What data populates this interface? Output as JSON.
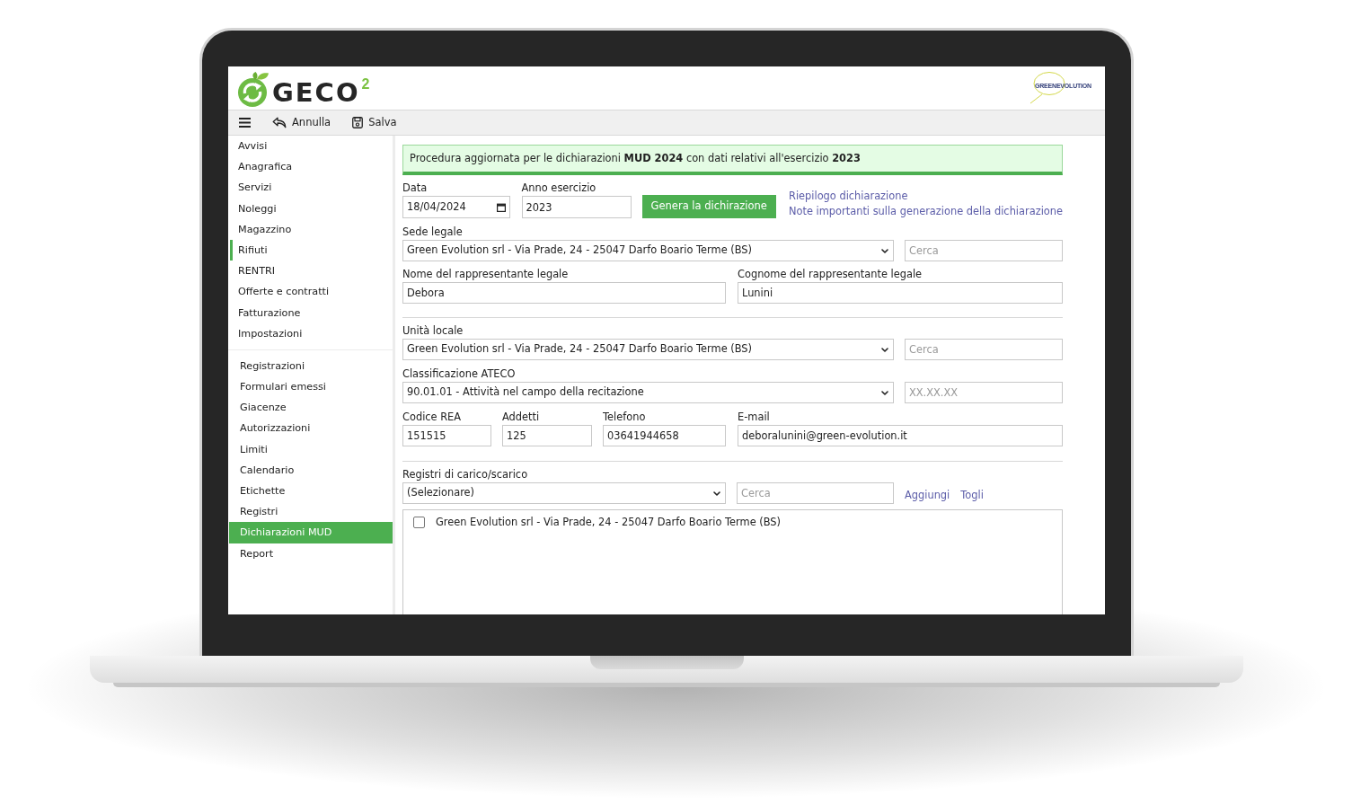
{
  "header": {
    "logo": {
      "text": "GECO",
      "superscript": "2"
    },
    "partner_logo": {
      "text": "GREENEVOLUTION"
    }
  },
  "toolbar": {
    "buttons": [
      {
        "kind": "undo",
        "label": "Annulla"
      },
      {
        "kind": "save",
        "label": "Salva"
      }
    ]
  },
  "sidebar": {
    "groups": [
      {
        "kind": "modules",
        "items": [
          {
            "label": "Avvisi",
            "selected": false
          },
          {
            "label": "Anagrafica",
            "selected": false
          },
          {
            "label": "Servizi",
            "selected": false
          },
          {
            "label": "Noleggi",
            "selected": false
          },
          {
            "label": "Magazzino",
            "selected": false
          },
          {
            "label": "Rifiuti",
            "selected": true
          },
          {
            "label": "RENTRI",
            "selected": false
          },
          {
            "label": "Offerte e contratti",
            "selected": false
          },
          {
            "label": "Fatturazione",
            "selected": false
          },
          {
            "label": "Impostazioni",
            "selected": false
          }
        ]
      },
      {
        "kind": "pages",
        "items": [
          {
            "label": "Registrazioni",
            "selected": false
          },
          {
            "label": "Formulari emessi",
            "selected": false
          },
          {
            "label": "Giacenze",
            "selected": false
          },
          {
            "label": "Autorizzazioni",
            "selected": false
          },
          {
            "label": "Limiti",
            "selected": false
          },
          {
            "label": "Calendario",
            "selected": false
          },
          {
            "label": "Etichette",
            "selected": false
          },
          {
            "label": "Registri",
            "selected": false
          },
          {
            "label": "Dichiarazioni MUD",
            "selected": true
          },
          {
            "label": "Report",
            "selected": false
          }
        ]
      }
    ]
  },
  "notice": {
    "text": "Procedura aggiornata per le dichiarazioni **MUD 2024** con dati relativi all'esercizio **2023**"
  },
  "declaration": {
    "date": {
      "label": "Data",
      "value": "18/04/2024"
    },
    "year": {
      "label": "Anno esercizio",
      "value": "2023"
    },
    "generate_button": {
      "label": "Genera la dichirazione"
    },
    "links": [
      {
        "label": "Riepilogo dichiarazione"
      },
      {
        "label": "Note importanti sulla generazione della dichiarazione"
      }
    ]
  },
  "registered_office": {
    "label": "Sede legale",
    "value": "Green Evolution srl - Via Prade, 24 - 25047 Darfo Boario Terme (BS)",
    "search": {
      "placeholder": "Cerca"
    }
  },
  "legal_representative": [
    {
      "label": "Nome del rappresentante legale",
      "value": "Debora"
    },
    {
      "label": "Cognome del rappresentante legale",
      "value": "Lunini"
    }
  ],
  "local_unit": {
    "label": "Unità locale",
    "value": "Green Evolution srl - Via Prade, 24 - 25047 Darfo Boario Terme (BS)",
    "search": {
      "placeholder": "Cerca"
    }
  },
  "ateco": {
    "label": "Classificazione ATECO",
    "value": "90.01.01 - Attività nel campo della recitazione",
    "search": {
      "placeholder": "XX.XX.XX"
    }
  },
  "company_fields": [
    {
      "label": "Codice REA",
      "value": "151515"
    },
    {
      "label": "Addetti",
      "value": "125"
    },
    {
      "label": "Telefono",
      "value": "03641944658"
    },
    {
      "label": "E-mail",
      "value": "deboralunini@green-evolution.it"
    }
  ],
  "registers": {
    "label": "Registri di carico/scarico",
    "select": {
      "value": "(Selezionare)"
    },
    "search": {
      "placeholder": "Cerca"
    },
    "links": [
      {
        "label": "Aggiungi"
      },
      {
        "label": "Togli"
      }
    ],
    "items": [
      {
        "label": "Green Evolution srl - Via Prade, 24 - 25047 Darfo Boario Terme (BS)",
        "checked": false
      }
    ]
  }
}
